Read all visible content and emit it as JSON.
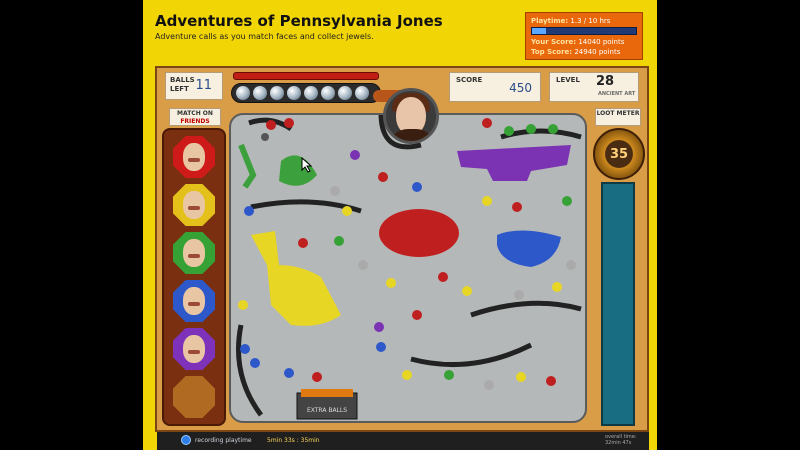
{
  "header": {
    "title": "Adventures of Pennsylvania Jones",
    "subtitle": "Adventure calls as you match faces and collect jewels."
  },
  "stats": {
    "playtime_label": "Playtime:",
    "playtime_value": "1.3 / 10 hrs",
    "playtime_fraction": 0.13,
    "your_score_label": "Your Score:",
    "your_score_value": "14040 points",
    "top_score_label": "Top Score:",
    "top_score_value": "24940 points"
  },
  "hud": {
    "balls_left_label": "BALLS LEFT",
    "balls_left_value": "11",
    "score_label": "SCORE",
    "score_value": "450",
    "level_label": "LEVEL",
    "level_value": "28",
    "level_sub": "ANCIENT ART",
    "match_on_label": "MATCH ON",
    "match_on_value": "FRIENDS",
    "loot_meter_label": "LOOT METER",
    "loot_value": "35",
    "extra_balls_label": "EXTRA BALLS"
  },
  "match_colors": [
    "#cf1a1a",
    "#e3c11a",
    "#36a236",
    "#2d58c9",
    "#7e31b9"
  ],
  "footer": {
    "recording_label": "recording playtime",
    "recording_time": "5min 33s",
    "recording_extra": ": 35min",
    "overall_label": "overall time:",
    "overall_value": "32min 47s"
  }
}
